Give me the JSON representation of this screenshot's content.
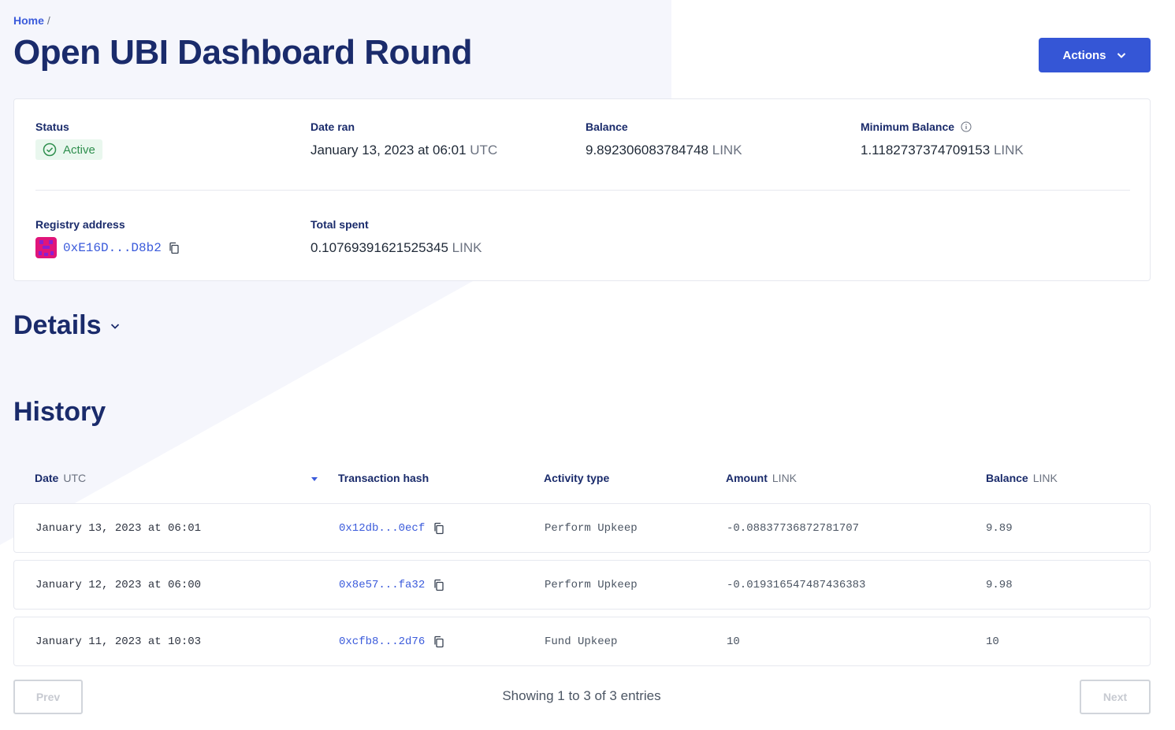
{
  "breadcrumb": {
    "home": "Home",
    "separator": "/"
  },
  "title": "Open UBI Dashboard Round",
  "actions_label": "Actions",
  "summary": {
    "status_label": "Status",
    "status_value": "Active",
    "date_ran_label": "Date ran",
    "date_ran_value": "January 13, 2023 at 06:01",
    "date_ran_unit": "UTC",
    "balance_label": "Balance",
    "balance_value": "9.892306083784748",
    "balance_unit": "LINK",
    "min_balance_label": "Minimum Balance",
    "min_balance_value": "1.1182737374709153",
    "min_balance_unit": "LINK",
    "registry_label": "Registry address",
    "registry_value": "0xE16D...D8b2",
    "total_spent_label": "Total spent",
    "total_spent_value": "0.10769391621525345",
    "total_spent_unit": "LINK"
  },
  "details_title": "Details",
  "history_title": "History",
  "table": {
    "headers": {
      "date": "Date",
      "date_unit": "UTC",
      "hash": "Transaction hash",
      "activity": "Activity type",
      "amount": "Amount",
      "amount_unit": "LINK",
      "balance": "Balance",
      "balance_unit": "LINK"
    },
    "rows": [
      {
        "date": "January 13, 2023 at 06:01",
        "hash": "0x12db...0ecf",
        "activity": "Perform Upkeep",
        "amount": "-0.08837736872781707",
        "balance": "9.89"
      },
      {
        "date": "January 12, 2023 at 06:00",
        "hash": "0x8e57...fa32",
        "activity": "Perform Upkeep",
        "amount": "-0.019316547487436383",
        "balance": "9.98"
      },
      {
        "date": "January 11, 2023 at 10:03",
        "hash": "0xcfb8...2d76",
        "activity": "Fund Upkeep",
        "amount": "10",
        "balance": "10"
      }
    ]
  },
  "pagination": {
    "prev": "Prev",
    "next": "Next",
    "showing": "Showing 1 to 3 of 3 entries"
  },
  "colors": {
    "primary": "#3556d6",
    "navy": "#1a2b6b",
    "success": "#2f8f4e",
    "link": "#3b5bdb"
  }
}
